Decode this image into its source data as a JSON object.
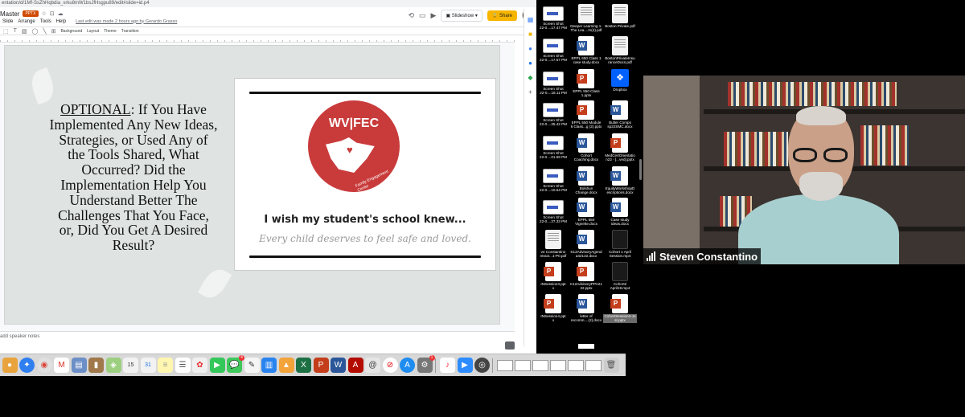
{
  "browser": {
    "url": "entation/d/1Mf-SsZhHqbdia_srku8mW1bsJfHsgpu89/edit#slide=id.p4"
  },
  "slides": {
    "doc_title": "Master",
    "file_badge": "PPTX",
    "menu": [
      "Slide",
      "Arrange",
      "Tools",
      "Help"
    ],
    "last_edit": "Last edit was made 2 hours ago by Gerardo Grasso",
    "slideshow_label": "Slideshow",
    "share_label": "Share",
    "toolbar": {
      "background": "Background",
      "layout": "Layout",
      "theme": "Theme",
      "transition": "Transition"
    },
    "slide": {
      "optional_word": "OPTIONAL",
      "question": ": If You Have Implemented Any New Ideas, Strategies, or Used Any of the Tools Shared, What Occurred? Did the Implementation Help You Understand Better The Challenges That You Face, or, Did You Get A Desired Result?",
      "logo_title": "WV|FEC",
      "logo_subtitle": "Family Engagement Center",
      "wish_text": "I wish my student's school knew...",
      "handwriting": "Every child deserves to feel safe and loved."
    },
    "speaker_notes_placeholder": "add speaker notes"
  },
  "desktop_files": [
    {
      "name": "Screen Shot\n22-0....17.47 PM",
      "type": "png"
    },
    {
      "name": "Deeper Learning 1-\nThe Lea....m(4).pdf",
      "type": "pdf"
    },
    {
      "name": "Boston Private.pdf",
      "type": "pdf"
    },
    {
      "name": "Screen Shot\n22-0....17.57 PM",
      "type": "png"
    },
    {
      "name": "EPPL 650 Class 1\ncase study.docx",
      "type": "docx"
    },
    {
      "name": "BostonPrivateInsu\nranceDocs.pdf",
      "type": "pdf"
    },
    {
      "name": "Screen Shot\n22-0....18.11 PM",
      "type": "png"
    },
    {
      "name": "EPPL 550 Class\n1.pptx",
      "type": "pptx"
    },
    {
      "name": "Dropbox",
      "type": "dropbox"
    },
    {
      "name": "Screen Shot\n22-0....25.42 PM",
      "type": "png"
    },
    {
      "name": "EPPL 550 Module\n6 Class...g (2).pptx",
      "type": "pptx"
    },
    {
      "name": "Butler Comps\nsp22SMC.docx",
      "type": "docx"
    },
    {
      "name": "Screen Shot\n22-0....01.59 PM",
      "type": "png"
    },
    {
      "name": "Cohort\nCoaching.docx",
      "type": "docx"
    },
    {
      "name": "MedCertOrientatio\nn22 - [...ved].pptx",
      "type": "pptx"
    },
    {
      "name": "Screen Shot\n22-0....10.54 PM",
      "type": "png"
    },
    {
      "name": "Bolshun\nChange.docx",
      "type": "docx"
    },
    {
      "name": "EquityWorkshopD\nescriptions.docx",
      "type": "docx"
    },
    {
      "name": "Screen Shot\n22-0....27.33 PM",
      "type": "png"
    },
    {
      "name": "EPPL 550\nVignette.docx",
      "type": "docx"
    },
    {
      "name": "Case study\nideas.docx",
      "type": "docx"
    },
    {
      "name": "ve Constantino\nntract...1-P0.pdf",
      "type": "pdf"
    },
    {
      "name": "K12AdvisoryAgend\na42122.docx",
      "type": "docx"
    },
    {
      "name": "Cohort 1 April\nSession.mp4",
      "type": "mp4"
    },
    {
      "name": "INSession3.ppt\nx",
      "type": "pptx"
    },
    {
      "name": "K12AdvisoryPPA21\n22.pptx",
      "type": "pptx"
    },
    {
      "name": "Cohort2\nApril19.mp4",
      "type": "mp4"
    },
    {
      "name": "INSession4.ppt\nx",
      "type": "pptx"
    },
    {
      "name": "letter of\nrecomm....(2).docx",
      "type": "docx"
    },
    {
      "name": "CohortSession3-Ju\nst.pptx",
      "type": "pptx",
      "selected": true
    }
  ],
  "video": {
    "participant_name": "Steven Constantino"
  },
  "dock": {
    "badges": {
      "calendar_day": "15",
      "calendar_month": "31",
      "messages": "4",
      "mail": "1"
    }
  },
  "colors": {
    "share_button": "#f7b500",
    "logo_red": "#c93b3b",
    "pptx_badge": "#d04a02",
    "word_blue": "#2b579a",
    "powerpoint_red": "#c43e1c"
  }
}
